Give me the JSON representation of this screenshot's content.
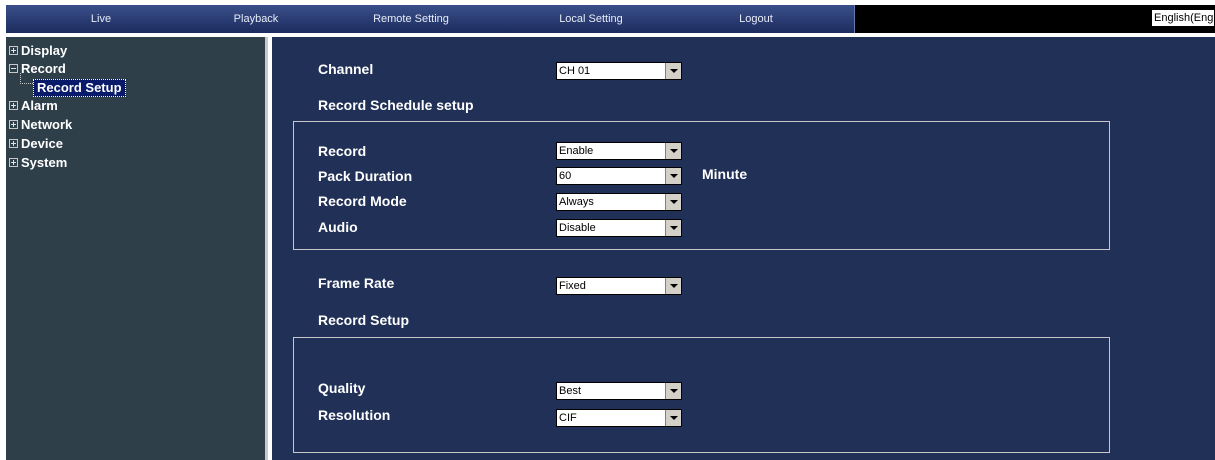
{
  "menu": {
    "live": "Live",
    "playback": "Playback",
    "remote_setting": "Remote Setting",
    "local_setting": "Local Setting",
    "logout": "Logout",
    "language": "English(Eng"
  },
  "sidebar": {
    "display": "Display",
    "record": "Record",
    "record_setup": "Record Setup",
    "alarm": "Alarm",
    "network": "Network",
    "device": "Device",
    "system": "System"
  },
  "form": {
    "channel_label": "Channel",
    "channel_value": "CH 01",
    "schedule_heading": "Record Schedule setup",
    "record_label": "Record",
    "record_value": "Enable",
    "pack_duration_label": "Pack Duration",
    "pack_duration_value": "60",
    "pack_duration_unit": "Minute",
    "record_mode_label": "Record Mode",
    "record_mode_value": "Always",
    "audio_label": "Audio",
    "audio_value": "Disable",
    "frame_rate_label": "Frame Rate",
    "frame_rate_value": "Fixed",
    "record_setup_heading": "Record Setup",
    "quality_label": "Quality",
    "quality_value": "Best",
    "resolution_label": "Resolution",
    "resolution_value": "CIF"
  },
  "colors": {
    "main_bg": "#213057",
    "sidebar_bg": "#2f3f4a",
    "menubar_top": "#3a4f8a",
    "menubar_bottom": "#1c2c5e",
    "selected_bg": "#0a1a6a"
  }
}
